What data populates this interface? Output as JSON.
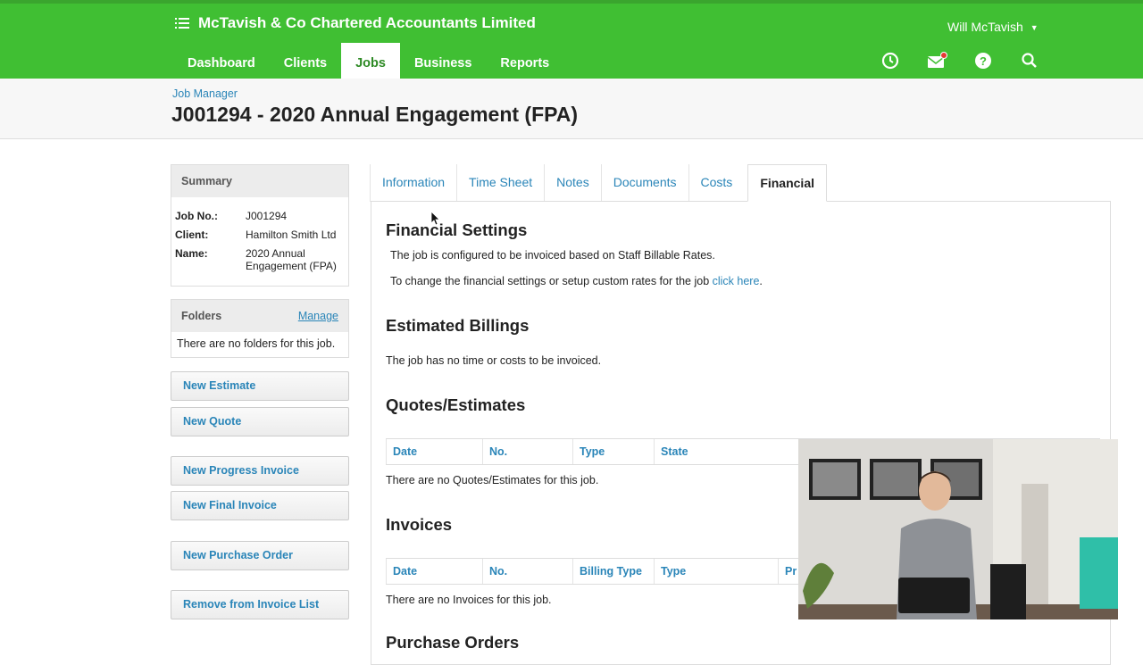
{
  "brand": {
    "name": "McTavish & Co Chartered Accountants Limited"
  },
  "user": {
    "name": "Will McTavish"
  },
  "nav": {
    "items": [
      "Dashboard",
      "Clients",
      "Jobs",
      "Business",
      "Reports"
    ],
    "active": "Jobs"
  },
  "breadcrumb": "Job Manager",
  "title": "J001294 - 2020 Annual Engagement (FPA)",
  "summary": {
    "heading": "Summary",
    "job_no_label": "Job No.:",
    "job_no": "J001294",
    "client_label": "Client:",
    "client": "Hamilton Smith Ltd",
    "name_label": "Name:",
    "name": "2020 Annual Engagement (FPA)"
  },
  "folders": {
    "heading": "Folders",
    "manage": "Manage",
    "empty": "There are no folders for this job."
  },
  "actions": {
    "new_estimate": "New Estimate",
    "new_quote": "New Quote",
    "new_progress_invoice": "New Progress Invoice",
    "new_final_invoice": "New Final Invoice",
    "new_purchase_order": "New Purchase Order",
    "remove_from_invoice_list": "Remove from Invoice List"
  },
  "tabs": [
    "Information",
    "Time Sheet",
    "Notes",
    "Documents",
    "Costs",
    "Financial"
  ],
  "financial": {
    "settings_title": "Financial Settings",
    "settings_text": "The job is configured to be invoiced based on Staff Billable Rates.",
    "change_text": "To change the financial settings or setup custom rates for the job ",
    "change_link": "click here",
    "change_end": ".",
    "estimated_title": "Estimated Billings",
    "estimated_text": "The job has no time or costs to be invoiced.",
    "quotes_title": "Quotes/Estimates",
    "quotes_columns": [
      "Date",
      "No.",
      "Type",
      "State"
    ],
    "quotes_empty": "There are no Quotes/Estimates for this job.",
    "invoices_title": "Invoices",
    "invoices_columns": [
      "Date",
      "No.",
      "Billing Type",
      "Type",
      "Pr"
    ],
    "invoices_empty": "There are no Invoices for this job.",
    "purchase_title": "Purchase Orders"
  },
  "colors": {
    "brand_green": "#40bf33",
    "link_blue": "#2a85b8"
  }
}
